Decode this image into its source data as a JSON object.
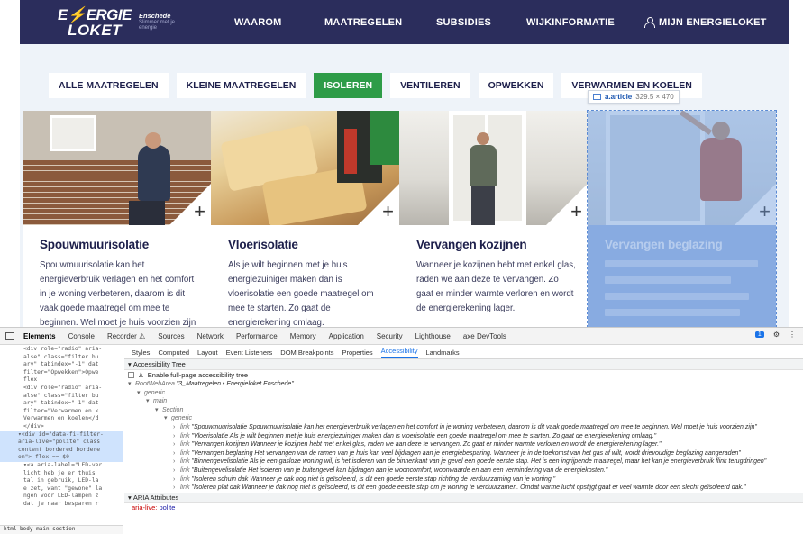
{
  "header": {
    "logo_top_left": "E",
    "logo_top_accent": "⚡",
    "logo_top_right": "ERGIE",
    "logo_bottom": "LOKET",
    "city": "Enschede",
    "tagline": "Slimmer met je energie",
    "nav": [
      "WAAROM",
      "MAATREGELEN",
      "SUBSIDIES",
      "WIJKINFORMATIE"
    ],
    "user_link": "MIJN ENERGIELOKET",
    "bg_color": "#2b2d5c"
  },
  "filters": {
    "items": [
      "ALLE MAATREGELEN",
      "KLEINE MAATREGELEN",
      "ISOLEREN",
      "VENTILEREN",
      "OPWEKKEN",
      "VERWARMEN EN KOELEN"
    ],
    "active": "ISOLEREN",
    "active_color": "#2e9c48"
  },
  "inspect_badge": {
    "selector": "a.article",
    "size": "329.5 × 470"
  },
  "cards": [
    {
      "title": "Spouwmuurisolatie",
      "text": "Spouwmuurisolatie kan het energieverbruik verlagen en het comfort in je woning verbeteren, daarom is dit vaak goede maatregel om mee te beginnen. Wel moet je huis voorzien zijn van een",
      "plus": "+"
    },
    {
      "title": "Vloerisolatie",
      "text": "Als je wilt beginnen met je huis energiezuiniger maken dan is vloerisolatie een goede maatregel om mee te starten. Zo gaat de energierekening omlaag.",
      "plus": "+"
    },
    {
      "title": "Vervangen kozijnen",
      "text": "Wanneer je kozijnen hebt met enkel glas, raden we aan deze te vervangen. Zo gaat er minder warmte verloren en wordt de energierekening lager.",
      "plus": "+"
    },
    {
      "title": "Vervangen beglazing",
      "text": "",
      "plus": "+"
    }
  ],
  "devtools": {
    "tabs": [
      "Elements",
      "Console",
      "Recorder ⚠",
      "Sources",
      "Network",
      "Performance",
      "Memory",
      "Application",
      "Security",
      "Lighthouse",
      "axe DevTools"
    ],
    "active_tab": "Elements",
    "issues_badge": "1",
    "sub_tabs": [
      "Styles",
      "Computed",
      "Layout",
      "Event Listeners",
      "DOM Breakpoints",
      "Properties",
      "Accessibility",
      "Landmarks"
    ],
    "active_sub_tab": "Accessibility",
    "a11y_tree_header": "Accessibility Tree",
    "enable_label": "Enable full-page accessibility tree",
    "tree": [
      {
        "depth": 0,
        "arrow": "▾",
        "role": "RootWebArea",
        "name": "\"3_Maatregelen • Energieloket Enschede\""
      },
      {
        "depth": 1,
        "arrow": "▾",
        "role": "generic",
        "name": ""
      },
      {
        "depth": 2,
        "arrow": "▾",
        "role": "main",
        "name": ""
      },
      {
        "depth": 3,
        "arrow": "▾",
        "role": "Section",
        "name": ""
      },
      {
        "depth": 4,
        "arrow": "▾",
        "role": "generic",
        "name": ""
      },
      {
        "depth": 5,
        "arrow": "›",
        "role": "link",
        "name": "\"Spouwmuurisolatie Spouwmuurisolatie kan het energieverbruik verlagen en het comfort in je woning verbeteren, daarom is dit vaak goede maatregel om mee te beginnen. Wel moet je huis voorzien zijn\""
      },
      {
        "depth": 5,
        "arrow": "›",
        "role": "link",
        "name": "\"Vloerisolatie Als je wilt beginnen met je huis energiezuiniger maken dan is vloerisolatie een goede maatregel om mee te starten. Zo gaat de energierekening omlaag.\""
      },
      {
        "depth": 5,
        "arrow": "›",
        "role": "link",
        "name": "\"Vervangen kozijnen Wanneer je kozijnen hebt met enkel glas, raden we aan deze te vervangen. Zo gaat er minder warmte verloren en wordt de energierekening lager.\""
      },
      {
        "depth": 5,
        "arrow": "›",
        "role": "link",
        "name": "\"Vervangen beglazing Het vervangen van de ramen van je huis kan veel bijdragen aan je energiebesparing. Wanneer je in de toekomst van het gas af wilt, wordt drievoudige beglazing aangeraden\""
      },
      {
        "depth": 5,
        "arrow": "›",
        "role": "link",
        "name": "\"Binnengevelisolatie Als je een gasloze woning wil, is het isoleren van de binnenkant van je gevel een goede eerste stap. Het is een ingrijpende maatregel, maar het kan je energieverbruik flink terugdringen\""
      },
      {
        "depth": 5,
        "arrow": "›",
        "role": "link",
        "name": "\"Buitengevelisolatie Het isoleren van je buitengevel kan bijdragen aan je wooncomfort, woonwaarde en aan een vermindering van de energiekosten.\""
      },
      {
        "depth": 5,
        "arrow": "›",
        "role": "link",
        "name": "\"Isoleren schuin dak Wanneer je dak nog niet is geïsoleerd, is dit een goede eerste stap richting de verduurzaming van je woning.\""
      },
      {
        "depth": 5,
        "arrow": "›",
        "role": "link",
        "name": "\"Isoleren plat dak Wanneer je dak nog niet is geïsoleerd, is dit een goede eerste stap om je woning te verduurzamen. Omdat warme lucht opstijgt gaat er veel warmte door een slecht geïsoleerd dak.\""
      }
    ],
    "aria_header": "ARIA Attributes",
    "aria_attr": "aria-live:",
    "aria_value": "polite",
    "dom_lines": [
      {
        "text": "<div role=\"radio\" aria-",
        "sel": false
      },
      {
        "text": "alse\" class=\"filter bu",
        "sel": false
      },
      {
        "text": "ary\" tabindex=\"-1\" dat",
        "sel": false
      },
      {
        "text": "filter=\"Opwekken\">Opwe",
        "sel": false
      },
      {
        "text": "  flex",
        "sel": false
      },
      {
        "text": "<div role=\"radio\" aria-",
        "sel": false
      },
      {
        "text": "alse\" class=\"filter bu",
        "sel": false
      },
      {
        "text": "ary\" tabindex=\"-1\" dat",
        "sel": false
      },
      {
        "text": "filter=\"Verwarmen en k",
        "sel": false
      },
      {
        "text": "Verwarmen en koelen</d",
        "sel": false
      },
      {
        "text": "</div>",
        "sel": false
      },
      {
        "text": "▾<div id=\"data-fi-filter-",
        "sel": true
      },
      {
        "text": "aria-live=\"polite\" class",
        "sel": true
      },
      {
        "text": "content bordered bordere",
        "sel": true
      },
      {
        "text": "om\"> flex == $0",
        "sel": true
      },
      {
        "text": "▾<a aria-label=\"LED-ver",
        "sel": false
      },
      {
        "text": "licht heb je er thuis",
        "sel": false
      },
      {
        "text": "tal in gebruik, LED-la",
        "sel": false
      },
      {
        "text": "e zet, want \"gewone\" la",
        "sel": false
      },
      {
        "text": "ngen voor LED-lampen z",
        "sel": false
      },
      {
        "text": "dat je naar besparen r",
        "sel": false
      }
    ],
    "dom_status": "html  body  main  section"
  }
}
